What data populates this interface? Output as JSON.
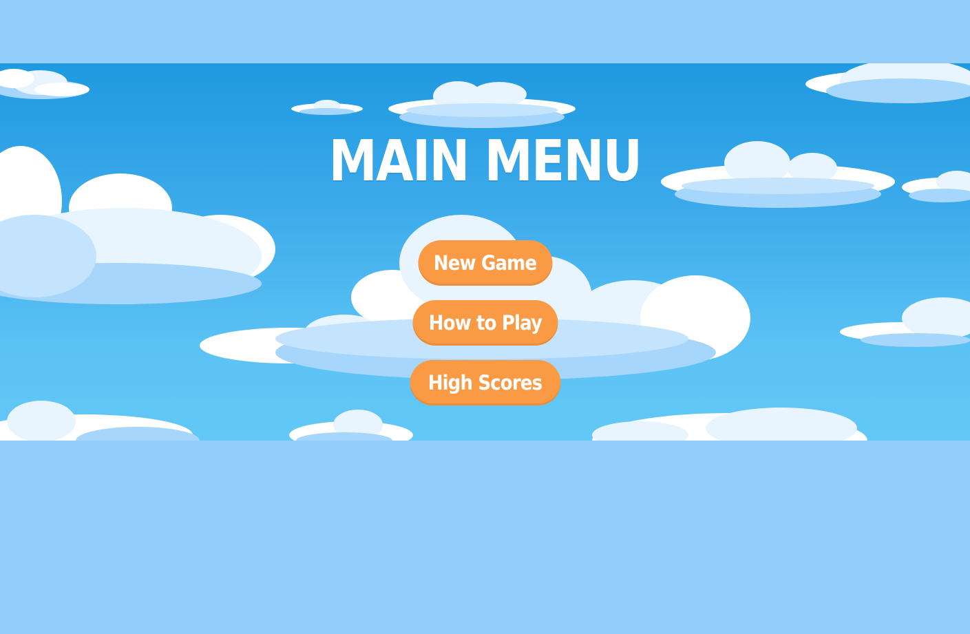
{
  "game": {
    "title": "MAIN MENU",
    "buttons": [
      {
        "label": "New Game"
      },
      {
        "label": "How to Play"
      },
      {
        "label": "High Scores"
      }
    ]
  },
  "colors": {
    "page_background": "#93cdfc",
    "sky_top": "#1f99e0",
    "sky_bottom": "#62c8f7",
    "button": "#fa9a45",
    "cloud": "#ffffff",
    "cloud_shade": "#a6d6fb",
    "text": "#ffffff"
  }
}
